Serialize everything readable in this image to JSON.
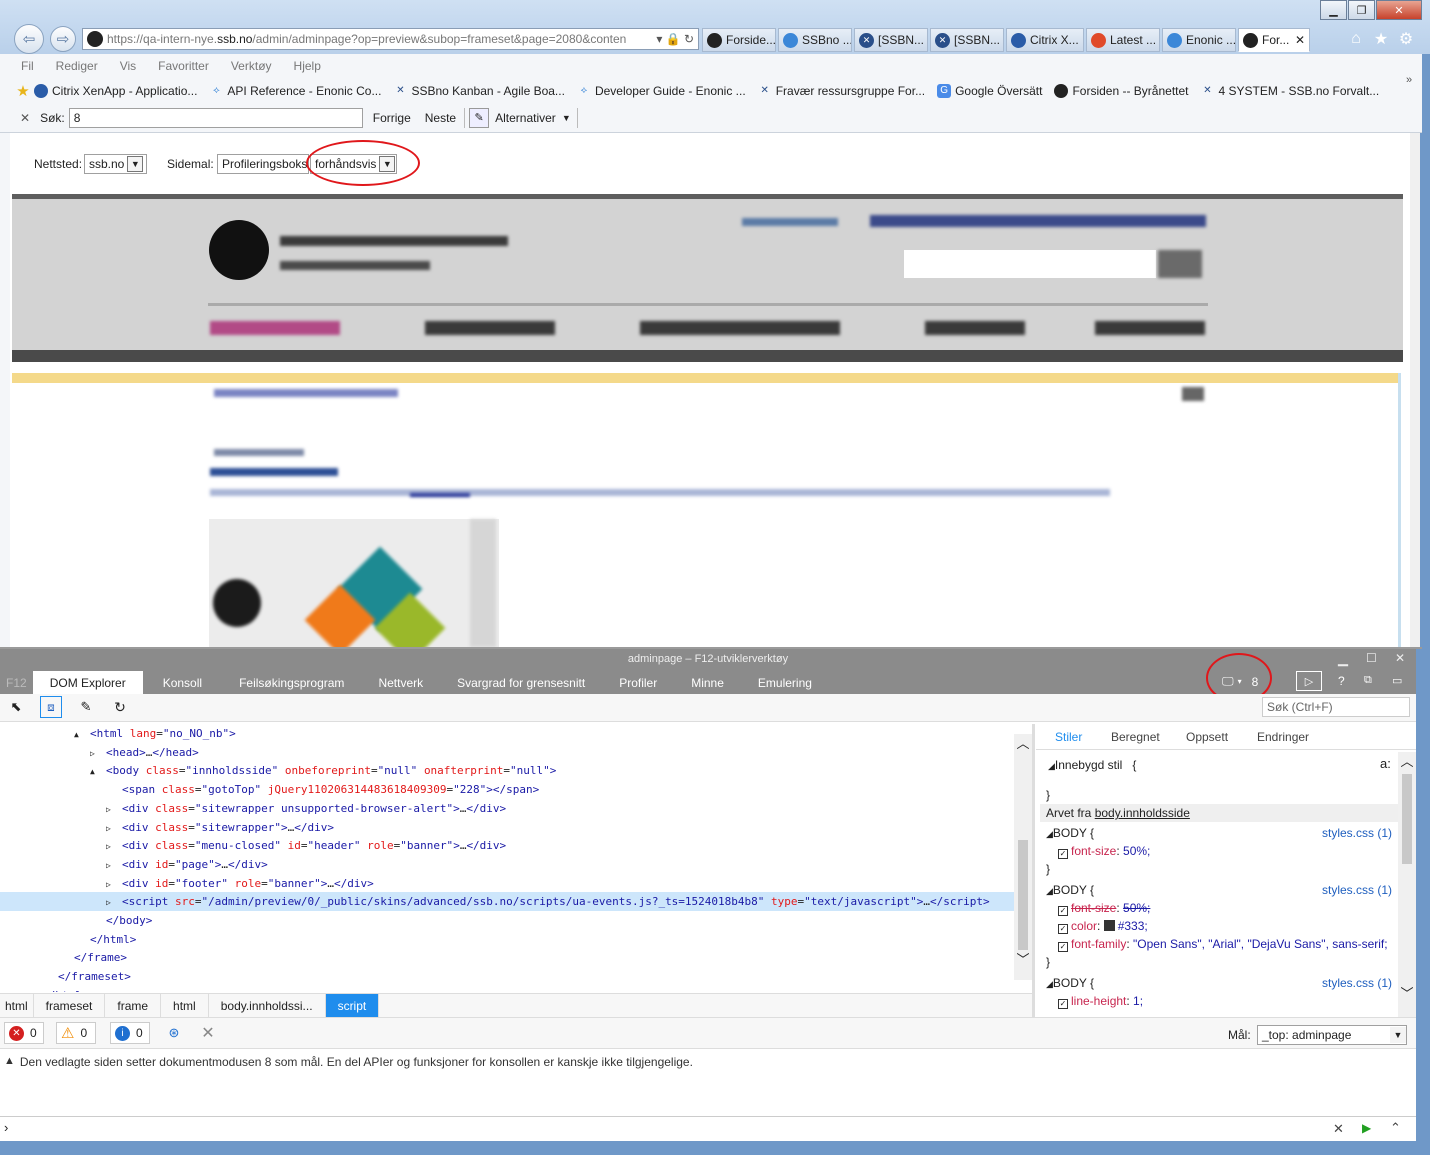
{
  "browser": {
    "url_pre": "https://qa-intern-nye.",
    "url_host": "ssb.no",
    "url_post": "/admin/adminpage?op=preview&subop=frameset&page=2080&conten",
    "tabs": [
      {
        "label": "Forside..."
      },
      {
        "label": "SSBno ..."
      },
      {
        "label": "[SSBN..."
      },
      {
        "label": "[SSBN..."
      },
      {
        "label": "Citrix X..."
      },
      {
        "label": "Latest ..."
      },
      {
        "label": "Enonic ..."
      },
      {
        "label": "For..."
      }
    ],
    "menu": [
      "Fil",
      "Rediger",
      "Vis",
      "Favoritter",
      "Verktøy",
      "Hjelp"
    ],
    "favorites": [
      {
        "label": "Citrix XenApp - Applicatio..."
      },
      {
        "label": "API Reference - Enonic Co..."
      },
      {
        "label": "SSBno Kanban - Agile Boa..."
      },
      {
        "label": "Developer Guide - Enonic ..."
      },
      {
        "label": "Fravær ressursgruppe For..."
      },
      {
        "label": "Google Översätt"
      },
      {
        "label": "Forsiden -- Byrånettet"
      },
      {
        "label": "4 SYSTEM - SSB.no Forvalt..."
      }
    ],
    "find": {
      "label": "Søk:",
      "value": "8",
      "prev": "Forrige",
      "next": "Neste",
      "options": "Alternativer"
    }
  },
  "preview": {
    "site_label": "Nettsted:",
    "site_value": "ssb.no",
    "template_label": "Sidemal:",
    "template_value": "Profileringsboks",
    "mode_value": "forhåndsvis"
  },
  "devtools": {
    "title": "adminpage – F12-utviklerverktøy",
    "f12": "F12",
    "tabs": [
      "DOM Explorer",
      "Konsoll",
      "Feilsøkingsprogram",
      "Nettverk",
      "Svargrad for grensesnitt",
      "Profiler",
      "Minne",
      "Emulering"
    ],
    "doc_mode": "8",
    "search_placeholder": "Søk (Ctrl+F)",
    "dom_lines": [
      {
        "indent": 4,
        "arrow": "▲",
        "html": "<span class='tg'>&lt;html</span> <span class='at'>lang</span>=<span class='av'>\"no_NO_nb\"</span><span class='tg'>&gt;</span>"
      },
      {
        "indent": 5,
        "arrow": "▷",
        "html": "<span class='tg'>&lt;head&gt;</span>…<span class='tg'>&lt;/head&gt;</span>"
      },
      {
        "indent": 5,
        "arrow": "▲",
        "html": "<span class='tg'>&lt;body</span> <span class='at'>class</span>=<span class='av'>\"innholdsside\"</span> <span class='at'>onbeforeprint</span>=<span class='av'>\"null\"</span> <span class='at'>onafterprint</span>=<span class='av'>\"null\"</span><span class='tg'>&gt;</span>"
      },
      {
        "indent": 6,
        "arrow": "",
        "html": "<span class='tg'>&lt;span</span> <span class='at'>class</span>=<span class='av'>\"gotoTop\"</span> <span class='at'>jQuery1102063144836184093​09</span>=<span class='av'>\"228\"</span><span class='tg'>&gt;&lt;/span&gt;</span>"
      },
      {
        "indent": 6,
        "arrow": "▷",
        "html": "<span class='tg'>&lt;div</span> <span class='at'>class</span>=<span class='av'>\"sitewrapper unsupported-browser-alert\"</span><span class='tg'>&gt;</span>…<span class='tg'>&lt;/div&gt;</span>"
      },
      {
        "indent": 6,
        "arrow": "▷",
        "html": "<span class='tg'>&lt;div</span> <span class='at'>class</span>=<span class='av'>\"sitewrapper\"</span><span class='tg'>&gt;</span>…<span class='tg'>&lt;/div&gt;</span>"
      },
      {
        "indent": 6,
        "arrow": "▷",
        "html": "<span class='tg'>&lt;div</span> <span class='at'>class</span>=<span class='av'>\"menu-closed\"</span> <span class='at'>id</span>=<span class='av'>\"header\"</span> <span class='at'>role</span>=<span class='av'>\"banner\"</span><span class='tg'>&gt;</span>…<span class='tg'>&lt;/div&gt;</span>"
      },
      {
        "indent": 6,
        "arrow": "▷",
        "html": "<span class='tg'>&lt;div</span> <span class='at'>id</span>=<span class='av'>\"page\"</span><span class='tg'>&gt;</span>…<span class='tg'>&lt;/div&gt;</span>"
      },
      {
        "indent": 6,
        "arrow": "▷",
        "html": "<span class='tg'>&lt;div</span> <span class='at'>id</span>=<span class='av'>\"footer\"</span> <span class='at'>role</span>=<span class='av'>\"banner\"</span><span class='tg'>&gt;</span>…<span class='tg'>&lt;/div&gt;</span>"
      },
      {
        "indent": 6,
        "arrow": "▷",
        "selected": true,
        "html": "<span class='tg'>&lt;script</span> <span class='at'>src</span>=<span class='av'>\"/admin/preview/0/_public/skins/advanced/ssb.no/scripts/ua-events.js?_ts=1524018b4b8\"</span> <span class='at'>type</span>=<span class='av'>\"text/javascript\"</span><span class='tg'>&gt;</span>…<span class='tg'>&lt;/script&gt;</span>"
      },
      {
        "indent": 5,
        "arrow": "",
        "html": "<span class='tg'>&lt;/body&gt;</span>"
      },
      {
        "indent": 4,
        "arrow": "",
        "html": "<span class='tg'>&lt;/html&gt;</span>"
      },
      {
        "indent": 3,
        "arrow": "",
        "html": "<span class='tg'>&lt;/frame&gt;</span>"
      },
      {
        "indent": 2,
        "arrow": "",
        "html": "<span class='tg'>&lt;/frameset&gt;</span>"
      },
      {
        "indent": 1,
        "arrow": "",
        "html": "<span class='tg'>&lt;/html&gt;</span>"
      }
    ],
    "breadcrumbs": [
      "html",
      "frameset",
      "frame",
      "html",
      "body.innholdssi...",
      "script"
    ],
    "styles_tabs": [
      "Stiler",
      "Beregnet",
      "Oppsett",
      "Endringer"
    ],
    "inline_style": "Innebygd stil",
    "inherited_from": "Arvet fra",
    "inherited_link": "body.innholdsside",
    "rules": [
      {
        "selector": "BODY",
        "source": "styles.css (1)",
        "props": [
          {
            "name": "font-size",
            "value": "50%;",
            "struck": false
          }
        ]
      },
      {
        "selector": "BODY",
        "source": "styles.css (1)",
        "props": [
          {
            "name": "font-size",
            "value": "50%;",
            "struck": true
          },
          {
            "name": "color",
            "value": "#333;",
            "struck": false,
            "swatch": "#333333"
          },
          {
            "name": "font-family",
            "value": "\"Open Sans\", \"Arial\", \"DejaVu Sans\", sans-serif;",
            "struck": false
          }
        ]
      },
      {
        "selector": "BODY",
        "source": "styles.css (1)",
        "props": [
          {
            "name": "line-height",
            "value": "1;",
            "struck": false
          }
        ]
      }
    ],
    "counts": {
      "errors": "0",
      "warnings": "0",
      "info": "0"
    },
    "target_label": "Mål:",
    "target_value": "_top: adminpage",
    "console_message": "Den vedlagte siden setter dokumentmodusen 8 som mål. En del APIer og funksjoner for konsollen er kanskje ikke tilgjengelige."
  },
  "colors": {
    "accent": "#1f8ded",
    "annotation": "#e0171b"
  }
}
